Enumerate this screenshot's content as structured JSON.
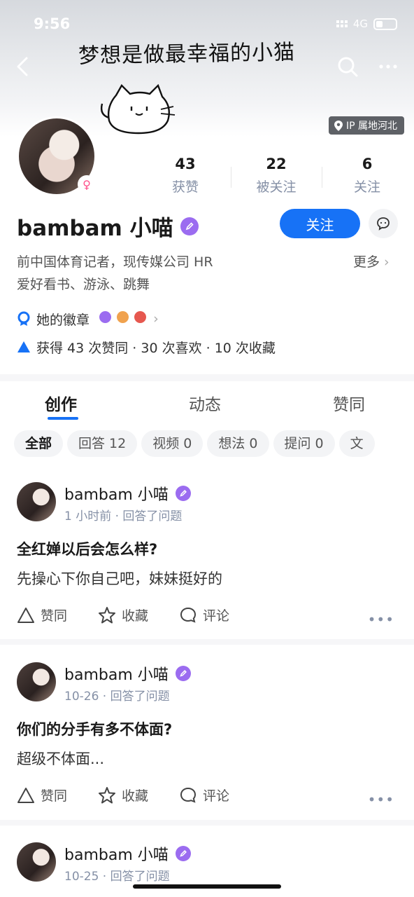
{
  "status_bar": {
    "time": "9:56",
    "network": "4G"
  },
  "header": {
    "handwriting": "梦想是做最幸福的小猫",
    "ip_location": "IP 属地河北"
  },
  "profile": {
    "name": "bambam 小喵",
    "stats": [
      {
        "value": "43",
        "label": "获赞"
      },
      {
        "value": "22",
        "label": "被关注"
      },
      {
        "value": "6",
        "label": "关注"
      }
    ],
    "follow_label": "关注",
    "bio": [
      "前中国体育记者，现传媒公司 HR",
      "爱好看书、游泳、跳舞"
    ],
    "more_label": "更多",
    "medals_label": "她的徽章",
    "agree_summary": "获得 43 次赞同 · 30 次喜欢 · 10 次收藏"
  },
  "tabs": [
    "创作",
    "动态",
    "赞同"
  ],
  "filter_chips": [
    "全部",
    "回答 12",
    "视频 0",
    "想法 0",
    "提问 0",
    "文"
  ],
  "actions": {
    "like": "赞同",
    "collect": "收藏",
    "comment": "评论"
  },
  "posts": [
    {
      "author": "bambam 小喵",
      "meta": "1 小时前 · 回答了问题",
      "title": "全红婵以后会怎么样?",
      "excerpt": "先操心下你自己吧，妹妹挺好的"
    },
    {
      "author": "bambam 小喵",
      "meta": "10-26 · 回答了问题",
      "title": "你们的分手有多不体面?",
      "excerpt": "超级不体面..."
    },
    {
      "author": "bambam 小喵",
      "meta": "10-25 · 回答了问题",
      "title": "",
      "excerpt": ""
    }
  ],
  "colors": {
    "accent": "#1772f6",
    "verified_badge": "#9b6cf0",
    "muted_text": "#8590a6"
  }
}
